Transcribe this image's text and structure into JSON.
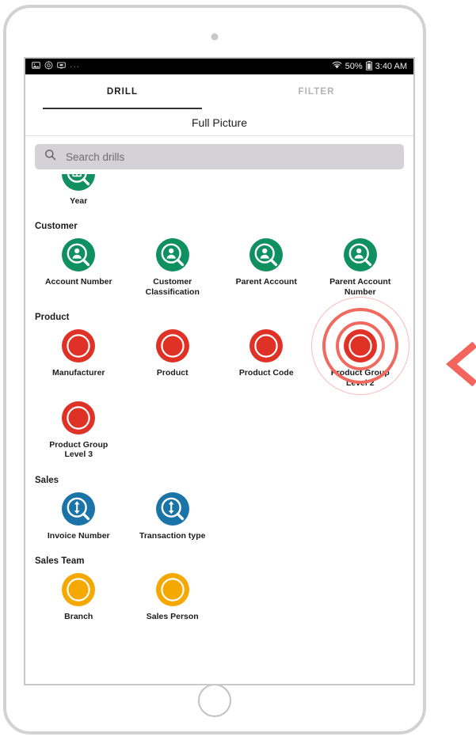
{
  "status_bar": {
    "left_icons": [
      "image-icon",
      "settings-gear-icon",
      "cast-screen-icon"
    ],
    "overflow": "···",
    "wifi_icon": "wifi-icon",
    "battery_percent": "50%",
    "battery_icon": "battery-icon",
    "time": "3:40 AM"
  },
  "tabs": [
    {
      "label": "DRILL",
      "active": true
    },
    {
      "label": "FILTER",
      "active": false
    }
  ],
  "title": "Full Picture",
  "search": {
    "placeholder": "Search drills",
    "value": "",
    "icon": "search-icon"
  },
  "colors": {
    "green": "#0f9061",
    "red": "#e03127",
    "blue": "#1a74a8",
    "amber": "#f5a800",
    "ripple": "#f06a60",
    "pointer": "#f4645c",
    "status_bar_bg": "#000000",
    "search_bg": "#d4d2d6",
    "tab_active": "#333333",
    "tab_inactive": "#b3b3b3"
  },
  "sections": [
    {
      "title": "",
      "clipped": true,
      "items": [
        {
          "label": "Year",
          "icon": "calendar-magnifier-icon",
          "color": "green"
        }
      ]
    },
    {
      "title": "Customer",
      "clipped": false,
      "items": [
        {
          "label": "Account Number",
          "icon": "person-magnifier-icon",
          "color": "green"
        },
        {
          "label": "Customer\nClassification",
          "icon": "person-magnifier-icon",
          "color": "green"
        },
        {
          "label": "Parent Account",
          "icon": "person-magnifier-icon",
          "color": "green"
        },
        {
          "label": "Parent Account\nNumber",
          "icon": "person-magnifier-icon",
          "color": "green"
        }
      ]
    },
    {
      "title": "Product",
      "clipped": false,
      "items": [
        {
          "label": "Manufacturer",
          "icon": "ring-circle-icon",
          "color": "red"
        },
        {
          "label": "Product",
          "icon": "ring-circle-icon",
          "color": "red"
        },
        {
          "label": "Product Code",
          "icon": "ring-circle-icon",
          "color": "red"
        },
        {
          "label": "Product Group\nLevel 2",
          "icon": "ring-circle-icon",
          "color": "red",
          "tapped": true
        },
        {
          "label": "Product Group\nLevel 3",
          "icon": "ring-circle-icon",
          "color": "red"
        }
      ]
    },
    {
      "title": "Sales",
      "clipped": false,
      "items": [
        {
          "label": "Invoice Number",
          "icon": "arrows-magnifier-icon",
          "color": "blue"
        },
        {
          "label": "Transaction type",
          "icon": "arrows-magnifier-icon",
          "color": "blue"
        }
      ]
    },
    {
      "title": "Sales Team",
      "clipped": false,
      "items": [
        {
          "label": "Branch",
          "icon": "ring-circle-icon",
          "color": "amber"
        },
        {
          "label": "Sales Person",
          "icon": "ring-circle-icon",
          "color": "amber"
        }
      ]
    }
  ],
  "annotation": {
    "pointer_icon": "chevron-left-icon",
    "ripple_icon": "tap-ripple-icon"
  }
}
